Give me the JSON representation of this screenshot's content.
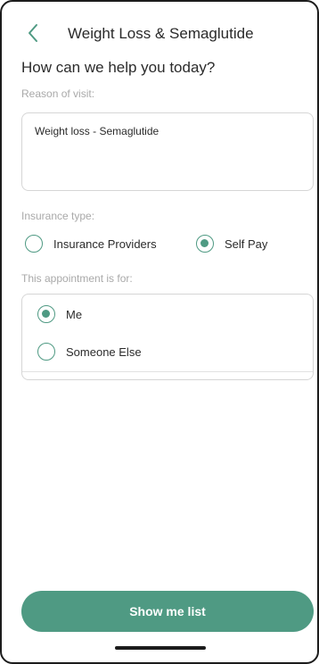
{
  "header": {
    "title": "Weight Loss & Semaglutide",
    "back_icon": "chevron-left-icon"
  },
  "heading": "How can we help you today?",
  "reason": {
    "label": "Reason of visit:",
    "value": "Weight loss - Semaglutide"
  },
  "insurance": {
    "label": "Insurance type:",
    "options": [
      {
        "label": "Insurance Providers",
        "selected": false
      },
      {
        "label": "Self Pay",
        "selected": true
      }
    ]
  },
  "appointment": {
    "label": "This appointment is for:",
    "options": [
      {
        "label": "Me",
        "selected": true
      },
      {
        "label": "Someone Else",
        "selected": false
      }
    ]
  },
  "submit_label": "Show me list",
  "colors": {
    "accent": "#4f9a83",
    "border": "#d6d6d6",
    "muted_text": "#a9a9a9"
  }
}
